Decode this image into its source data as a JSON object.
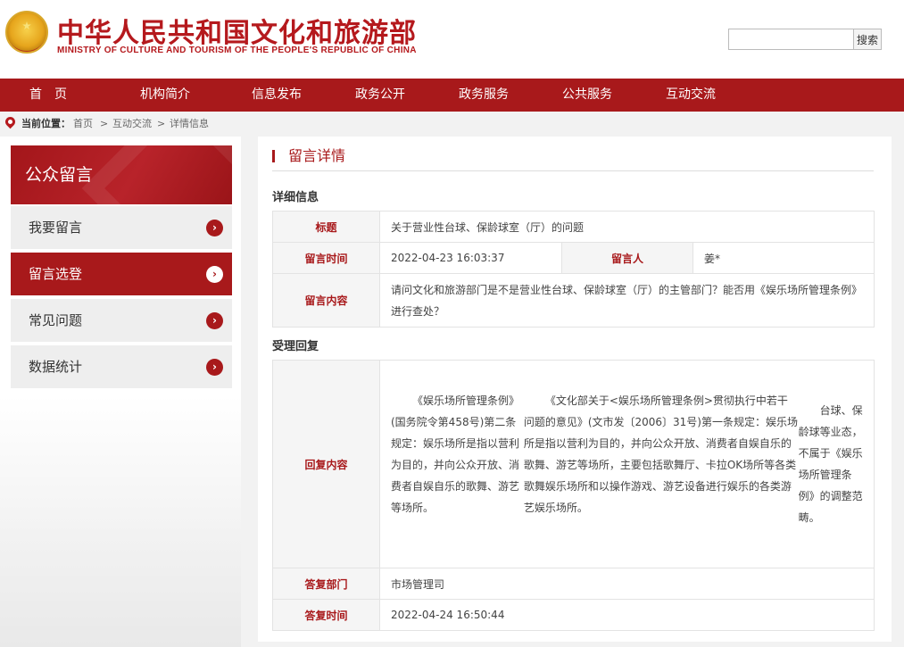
{
  "header": {
    "title": "中华人民共和国文化和旅游部",
    "subtitle": "MINISTRY OF CULTURE AND TOURISM OF THE PEOPLE'S REPUBLIC OF CHINA",
    "search_placeholder": "",
    "search_label": "搜索"
  },
  "nav": {
    "items": [
      {
        "label": "首　页"
      },
      {
        "label": "机构简介"
      },
      {
        "label": "信息发布"
      },
      {
        "label": "政务公开"
      },
      {
        "label": "政务服务"
      },
      {
        "label": "公共服务"
      },
      {
        "label": "互动交流"
      }
    ]
  },
  "breadcrumb": {
    "label": "当前位置：",
    "items": [
      "首页",
      "互动交流",
      "详情信息"
    ],
    "separator": ">"
  },
  "sidebar": {
    "title": "公众留言",
    "items": [
      {
        "label": "我要留言",
        "active": false
      },
      {
        "label": "留言选登",
        "active": true
      },
      {
        "label": "常见问题",
        "active": false
      },
      {
        "label": "数据统计",
        "active": false
      }
    ],
    "arrow": "›"
  },
  "main": {
    "panel_title": "留言详情",
    "detail_heading": "详细信息",
    "reply_heading": "受理回复",
    "detail": {
      "title_label": "标题",
      "title_value": "关于营业性台球、保龄球室（厅）的问题",
      "time_label": "留言时间",
      "time_value": "2022-04-23 16:03:37",
      "author_label": "留言人",
      "author_value": "姜*",
      "content_label": "留言内容",
      "content_value": "请问文化和旅游部门是不是营业性台球、保龄球室（厅）的主管部门？能否用《娱乐场所管理条例》进行查处？"
    },
    "reply": {
      "content_label": "回复内容",
      "paragraphs": [
        "《娱乐场所管理条例》(国务院令第458号)第二条规定：娱乐场所是指以营利为目的，并向公众开放、消费者自娱自乐的歌舞、游艺等场所。",
        "《文化部关于<娱乐场所管理条例>贯彻执行中若干问题的意见》(文市发〔2006〕31号)第一条规定：娱乐场所是指以营利为目的，并向公众开放、消费者自娱自乐的歌舞、游艺等场所，主要包括歌舞厅、卡拉OK场所等各类歌舞娱乐场所和以操作游戏、游艺设备进行娱乐的各类游艺娱乐场所。",
        "台球、保龄球等业态，不属于《娱乐场所管理条例》的调整范畴。"
      ],
      "dept_label": "答复部门",
      "dept_value": "市场管理司",
      "time_label": "答复时间",
      "time_value": "2022-04-24 16:50:44"
    }
  },
  "colors": {
    "brand": "#a8191b",
    "background": "#f2f2f2"
  }
}
